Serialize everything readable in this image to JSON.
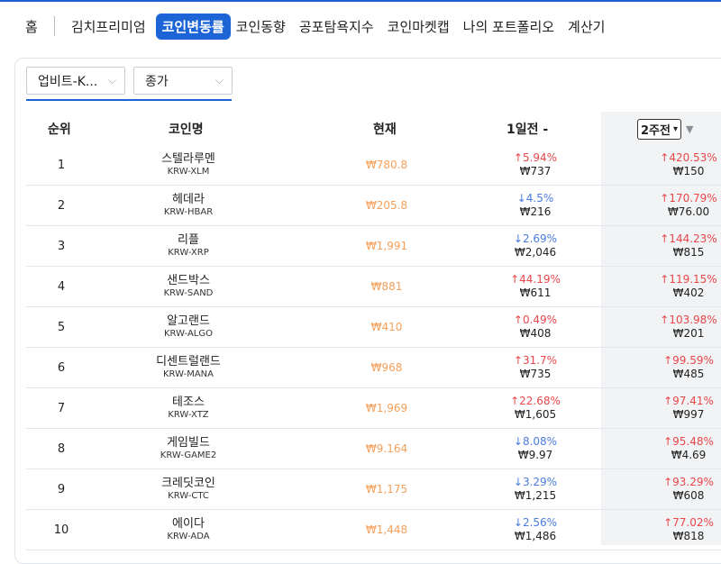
{
  "nav": {
    "home": "홈",
    "items": [
      "김치프리미엄",
      "코인변동률",
      "코인동향",
      "공포탐욕지수",
      "코인마켓캡",
      "나의 포트폴리오",
      "계산기"
    ],
    "active_index": 1
  },
  "filters": {
    "exchange": "업비트-K...",
    "price_type": "종가"
  },
  "table": {
    "headers": {
      "rank": "순위",
      "name": "코인명",
      "current": "현재",
      "day1": "1일전 -",
      "week2": "2주전"
    },
    "rows": [
      {
        "rank": "1",
        "name": "스텔라루멘",
        "code": "KRW-XLM",
        "price": "₩780.8",
        "d1_pct": "↑5.94%",
        "d1_dir": "up",
        "d1_amt": "₩737",
        "w2_pct": "↑420.53%",
        "w2_dir": "up",
        "w2_amt": "₩150"
      },
      {
        "rank": "2",
        "name": "헤데라",
        "code": "KRW-HBAR",
        "price": "₩205.8",
        "d1_pct": "↓4.5%",
        "d1_dir": "down",
        "d1_amt": "₩216",
        "w2_pct": "↑170.79%",
        "w2_dir": "up",
        "w2_amt": "₩76.00"
      },
      {
        "rank": "3",
        "name": "리플",
        "code": "KRW-XRP",
        "price": "₩1,991",
        "d1_pct": "↓2.69%",
        "d1_dir": "down",
        "d1_amt": "₩2,046",
        "w2_pct": "↑144.23%",
        "w2_dir": "up",
        "w2_amt": "₩815"
      },
      {
        "rank": "4",
        "name": "샌드박스",
        "code": "KRW-SAND",
        "price": "₩881",
        "d1_pct": "↑44.19%",
        "d1_dir": "up",
        "d1_amt": "₩611",
        "w2_pct": "↑119.15%",
        "w2_dir": "up",
        "w2_amt": "₩402"
      },
      {
        "rank": "5",
        "name": "알고랜드",
        "code": "KRW-ALGO",
        "price": "₩410",
        "d1_pct": "↑0.49%",
        "d1_dir": "up",
        "d1_amt": "₩408",
        "w2_pct": "↑103.98%",
        "w2_dir": "up",
        "w2_amt": "₩201"
      },
      {
        "rank": "6",
        "name": "디센트럴랜드",
        "code": "KRW-MANA",
        "price": "₩968",
        "d1_pct": "↑31.7%",
        "d1_dir": "up",
        "d1_amt": "₩735",
        "w2_pct": "↑99.59%",
        "w2_dir": "up",
        "w2_amt": "₩485"
      },
      {
        "rank": "7",
        "name": "테조스",
        "code": "KRW-XTZ",
        "price": "₩1,969",
        "d1_pct": "↑22.68%",
        "d1_dir": "up",
        "d1_amt": "₩1,605",
        "w2_pct": "↑97.41%",
        "w2_dir": "up",
        "w2_amt": "₩997"
      },
      {
        "rank": "8",
        "name": "게임빌드",
        "code": "KRW-GAME2",
        "price": "₩9.164",
        "d1_pct": "↓8.08%",
        "d1_dir": "down",
        "d1_amt": "₩9.97",
        "w2_pct": "↑95.48%",
        "w2_dir": "up",
        "w2_amt": "₩4.69"
      },
      {
        "rank": "9",
        "name": "크레딧코인",
        "code": "KRW-CTC",
        "price": "₩1,175",
        "d1_pct": "↓3.29%",
        "d1_dir": "down",
        "d1_amt": "₩1,215",
        "w2_pct": "↑93.29%",
        "w2_dir": "up",
        "w2_amt": "₩608"
      },
      {
        "rank": "10",
        "name": "에이다",
        "code": "KRW-ADA",
        "price": "₩1,448",
        "d1_pct": "↓2.56%",
        "d1_dir": "down",
        "d1_amt": "₩1,486",
        "w2_pct": "↑77.02%",
        "w2_dir": "up",
        "w2_amt": "₩818"
      }
    ]
  },
  "icons": {
    "dropdown": "chevron-down-icon",
    "sort": "sort-desc-icon"
  }
}
